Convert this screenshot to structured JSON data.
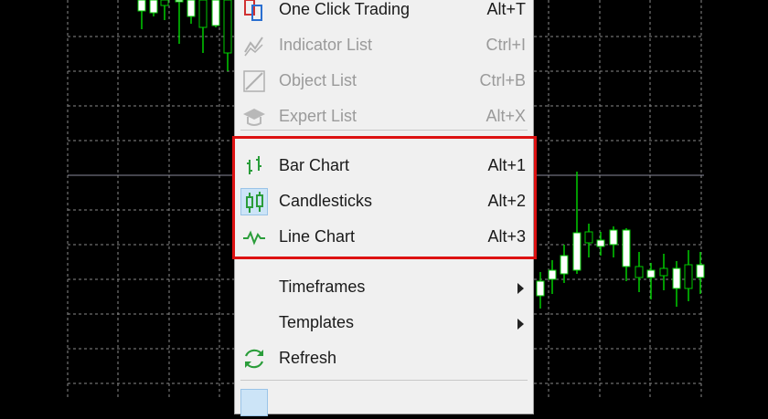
{
  "menu": {
    "items": [
      {
        "label": "One Click Trading",
        "shortcut": "Alt+T",
        "icon": "one-click-trading-icon"
      },
      {
        "label": "Indicator List",
        "shortcut": "Ctrl+I",
        "icon": "indicator-list-icon",
        "disabled": true
      },
      {
        "label": "Object List",
        "shortcut": "Ctrl+B",
        "icon": "object-list-icon",
        "disabled": true
      },
      {
        "label": "Expert List",
        "shortcut": "Alt+X",
        "icon": "expert-list-icon",
        "disabled": true
      },
      {
        "label": "Bar Chart",
        "shortcut": "Alt+1",
        "icon": "bar-chart-icon"
      },
      {
        "label": "Candlesticks",
        "shortcut": "Alt+2",
        "icon": "candlesticks-icon",
        "selected": true
      },
      {
        "label": "Line Chart",
        "shortcut": "Alt+3",
        "icon": "line-chart-icon"
      },
      {
        "label": "Timeframes",
        "submenu": true
      },
      {
        "label": "Templates",
        "submenu": true
      },
      {
        "label": "Refresh",
        "icon": "refresh-icon"
      }
    ]
  },
  "colors": {
    "chart_background": "#000000",
    "grid": "#8a8a8a",
    "bull_candle": "#ffffff",
    "bear_candle": "#000000",
    "wick": "#00cc00",
    "highlight_border": "#dd1111",
    "menu_background": "#f0f0f0",
    "icon_green": "#2a9d3a"
  }
}
